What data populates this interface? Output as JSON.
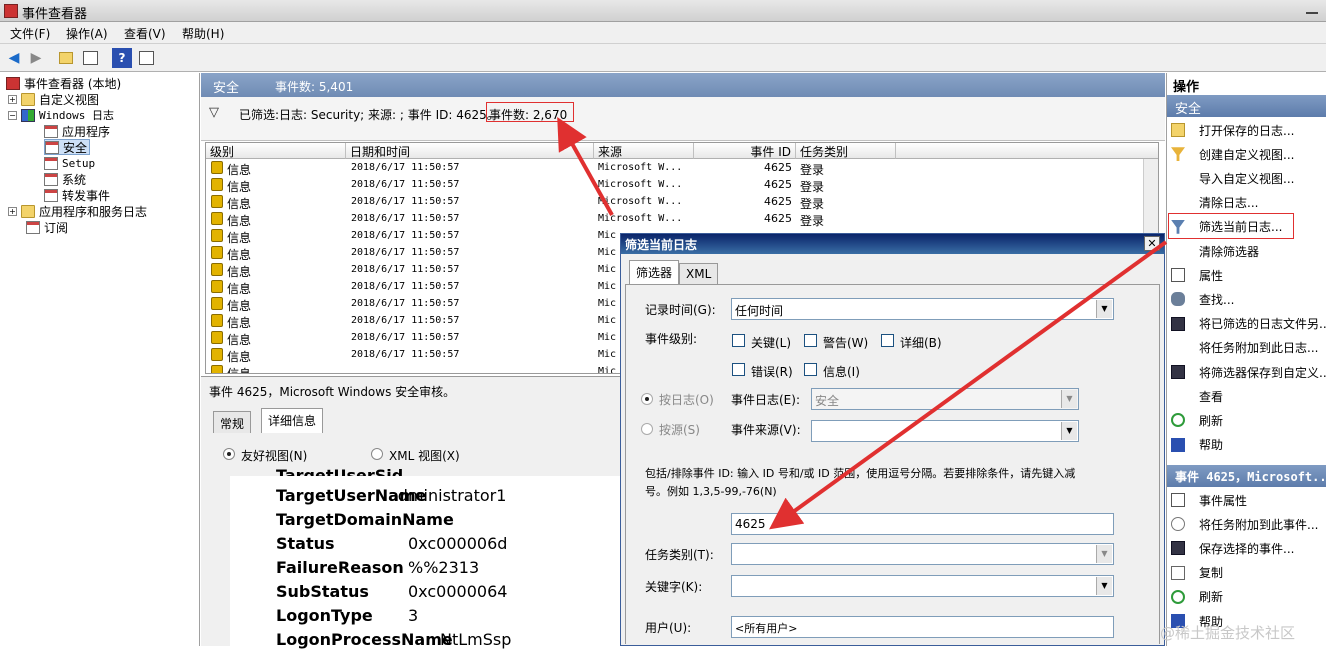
{
  "window": {
    "title": "事件查看器"
  },
  "menu": [
    "文件(F)",
    "操作(A)",
    "查看(V)",
    "帮助(H)"
  ],
  "toolbar": {
    "icons": [
      "back-icon",
      "forward-icon",
      "up-folder-icon",
      "properties-icon",
      "help-icon",
      "show-pane-icon"
    ]
  },
  "tree": {
    "root": "事件查看器 (本地)",
    "custom_views": "自定义视图",
    "windows_logs": "Windows 日志",
    "logs": [
      "应用程序",
      "安全",
      "Setup",
      "系统",
      "转发事件"
    ],
    "apps_services": "应用程序和服务日志",
    "subscriptions": "订阅"
  },
  "center": {
    "title": "安全",
    "event_count": "事件数: 5,401",
    "filter_text": "已筛选:日志: Security; 来源: ; 事件 ID: 4625。",
    "filter_count": "事件数: 2,670",
    "columns": [
      "级别",
      "日期和时间",
      "来源",
      "事件 ID",
      "任务类别"
    ],
    "rows": [
      {
        "level": "信息",
        "datetime": "2018/6/17 11:50:57",
        "source": "Microsoft W...",
        "id": "4625",
        "task": "登录"
      },
      {
        "level": "信息",
        "datetime": "2018/6/17 11:50:57",
        "source": "Microsoft W...",
        "id": "4625",
        "task": "登录"
      },
      {
        "level": "信息",
        "datetime": "2018/6/17 11:50:57",
        "source": "Microsoft W...",
        "id": "4625",
        "task": "登录"
      },
      {
        "level": "信息",
        "datetime": "2018/6/17 11:50:57",
        "source": "Microsoft W...",
        "id": "4625",
        "task": "登录"
      },
      {
        "level": "信息",
        "datetime": "2018/6/17 11:50:57",
        "source": "Mic",
        "id": "",
        "task": ""
      },
      {
        "level": "信息",
        "datetime": "2018/6/17 11:50:57",
        "source": "Mic",
        "id": "",
        "task": ""
      },
      {
        "level": "信息",
        "datetime": "2018/6/17 11:50:57",
        "source": "Mic",
        "id": "",
        "task": ""
      },
      {
        "level": "信息",
        "datetime": "2018/6/17 11:50:57",
        "source": "Mic",
        "id": "",
        "task": ""
      },
      {
        "level": "信息",
        "datetime": "2018/6/17 11:50:57",
        "source": "Mic",
        "id": "",
        "task": ""
      },
      {
        "level": "信息",
        "datetime": "2018/6/17 11:50:57",
        "source": "Mic",
        "id": "",
        "task": ""
      },
      {
        "level": "信息",
        "datetime": "2018/6/17 11:50:57",
        "source": "Mic",
        "id": "",
        "task": ""
      },
      {
        "level": "信息",
        "datetime": "2018/6/17 11:50:57",
        "source": "Mic",
        "id": "",
        "task": ""
      },
      {
        "level": "信息",
        "datetime": "",
        "source": "Mic",
        "id": "",
        "task": ""
      }
    ]
  },
  "detail": {
    "header": "事件 4625，Microsoft Windows 安全审核。",
    "tabs": [
      "常规",
      "详细信息"
    ],
    "friendly_view": "友好视图(N)",
    "xml_view": "XML 视图(X)",
    "fields": [
      {
        "k": "TargetUserName",
        "v": "administrator1"
      },
      {
        "k": "TargetDomainName",
        "v": ""
      },
      {
        "k": "Status",
        "v": "0xc000006d"
      },
      {
        "k": "FailureReason",
        "v": "%%2313"
      },
      {
        "k": "SubStatus",
        "v": "0xc0000064"
      },
      {
        "k": "LogonType",
        "v": "3"
      },
      {
        "k": "LogonProcessName",
        "v": "NtLmSsp"
      }
    ],
    "partial_top": "TargetUserSid"
  },
  "actions": {
    "header": "操作",
    "section1": "安全",
    "items1": [
      {
        "label": "打开保存的日志...",
        "icon": "open-folder-icon"
      },
      {
        "label": "创建自定义视图...",
        "icon": "filter-create-icon"
      },
      {
        "label": "导入自定义视图...",
        "icon": ""
      },
      {
        "label": "清除日志...",
        "icon": ""
      },
      {
        "label": "筛选当前日志...",
        "icon": "filter-icon"
      },
      {
        "label": "清除筛选器",
        "icon": ""
      },
      {
        "label": "属性",
        "icon": "properties-icon"
      },
      {
        "label": "查找...",
        "icon": "find-icon"
      },
      {
        "label": "将已筛选的日志文件另...",
        "icon": "save-icon"
      },
      {
        "label": "将任务附加到此日志...",
        "icon": ""
      },
      {
        "label": "将筛选器保存到自定义...",
        "icon": "save-filter-icon"
      },
      {
        "label": "查看",
        "icon": ""
      },
      {
        "label": "刷新",
        "icon": "refresh-icon"
      },
      {
        "label": "帮助",
        "icon": "help-icon"
      }
    ],
    "section2": "事件 4625，Microsoft...",
    "items2": [
      {
        "label": "事件属性",
        "icon": "event-properties-icon"
      },
      {
        "label": "将任务附加到此事件...",
        "icon": "attach-task-icon"
      },
      {
        "label": "保存选择的事件...",
        "icon": "save-icon"
      },
      {
        "label": "复制",
        "icon": "copy-icon"
      },
      {
        "label": "刷新",
        "icon": "refresh-icon"
      },
      {
        "label": "帮助",
        "icon": "help-icon"
      }
    ]
  },
  "dialog": {
    "title": "筛选当前日志",
    "close": "✕",
    "tabs": [
      "筛选器",
      "XML"
    ],
    "logged_label": "记录时间(G):",
    "logged_value": "任何时间",
    "level_label": "事件级别:",
    "levels": [
      "关键(L)",
      "警告(W)",
      "详细(B)",
      "错误(R)",
      "信息(I)"
    ],
    "by_log": "按日志(O)",
    "event_log_label": "事件日志(E):",
    "event_log_value": "安全",
    "by_source": "按源(S)",
    "event_source_label": "事件来源(V):",
    "help_text_1": "包括/排除事件 ID: 输入 ID 号和/或 ID 范围，使用逗号分隔。若要排除条件，请先键入减",
    "help_text_2": "号。例如 1,3,5-99,-76(N)",
    "event_id_value": "4625",
    "task_label": "任务类别(T):",
    "keyword_label": "关键字(K):",
    "user_label": "用户(U):",
    "user_value": "<所有用户>"
  },
  "watermark": "@稀土掘金技术社区",
  "colors": {
    "annotation": "#e03030",
    "header": "#6f8bb4",
    "dialog_title": "#0a246a"
  }
}
